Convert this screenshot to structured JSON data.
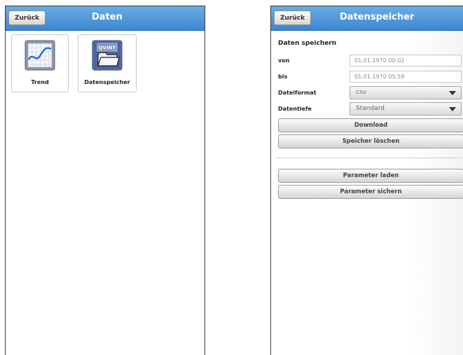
{
  "left": {
    "back_label": "Zurück",
    "title": "Daten",
    "tiles": [
      {
        "label": "Trend",
        "icon": "trend-chart-icon"
      },
      {
        "label": "Datenspeicher",
        "icon": "qvint-folder-icon",
        "icon_text": "QVINT"
      }
    ]
  },
  "right": {
    "back_label": "Zurück",
    "title": "Datenspeicher",
    "section_title": "Daten speichern",
    "von_label": "von",
    "von_value": "01.01.1970 00:02",
    "bis_label": "bis",
    "bis_value": "01.01.1970 05:59",
    "format_label": "Dateiformat",
    "format_value": "csv",
    "depth_label": "Datentiefe",
    "depth_value": "Standard",
    "download_label": "Download",
    "clear_label": "Speicher löschen",
    "load_params_label": "Parameter laden",
    "save_params_label": "Parameter sichern"
  },
  "colors": {
    "titlebar": "#3d86cf",
    "titlebar_light": "#6aaee6"
  }
}
